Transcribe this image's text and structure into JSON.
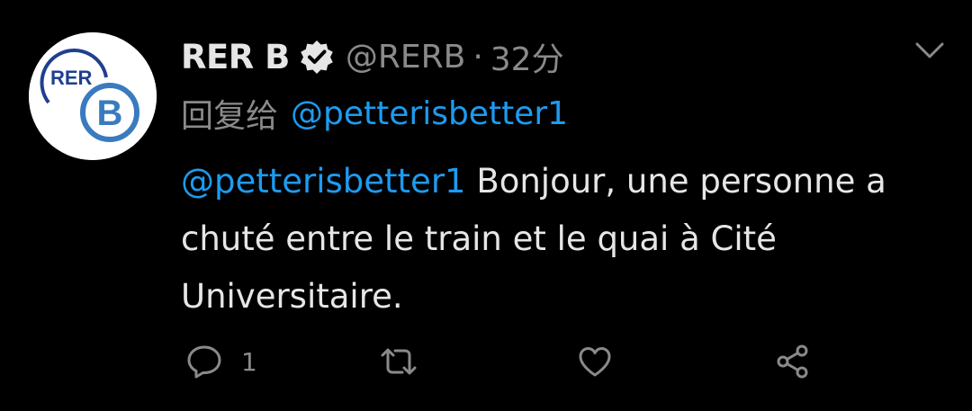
{
  "colors": {
    "background": "#000000",
    "accent": "#1d9bf0",
    "text_primary": "#e6e6e6",
    "text_secondary": "#8a8a8a",
    "avatar_blue": "#3a7bbf"
  },
  "tweet": {
    "avatar": {
      "icon": "rer-b-logo",
      "logo_text_top": "RER",
      "logo_text_letter": "B"
    },
    "author": {
      "display_name": "RER B",
      "verified_icon": "verified-badge-icon",
      "handle": "@RERB",
      "separator": "·",
      "time": "32分"
    },
    "reply_to": {
      "prefix": "回复给",
      "mention": "@petterisbetter1"
    },
    "body": {
      "mention": "@petterisbetter1",
      "text": " Bonjour, une personne a chuté entre le train et le quai à Cité Universitaire."
    },
    "menu_icon": "chevron-down-icon",
    "actions": {
      "reply": {
        "icon": "reply-icon",
        "count": "1"
      },
      "retweet": {
        "icon": "retweet-icon",
        "count": ""
      },
      "like": {
        "icon": "heart-icon",
        "count": ""
      },
      "share": {
        "icon": "share-icon",
        "count": ""
      }
    }
  }
}
